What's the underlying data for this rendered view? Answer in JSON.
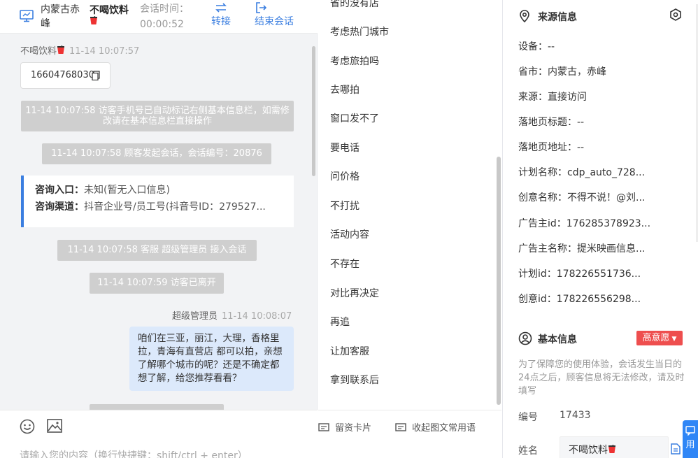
{
  "header": {
    "location": "内蒙古赤峰",
    "visitor_name": "不喝饮料",
    "session_label": "会话时间：",
    "session_time": "00:00:52",
    "transfer_label": "转接",
    "end_label": "结束会话"
  },
  "chat": {
    "visitor_name": "不喝饮料",
    "visitor_time": "11-14 10:07:57",
    "phone": "16604768030",
    "sys_auto_mark": "11-14 10:07:58 访客手机号已自动标记右侧基本信息栏，如需修改请在基本信息栏直接操作",
    "sys_session_start": "11-14 10:07:58 顾客发起会话，会话编号：20876",
    "consult_entry_label": "咨询入口：",
    "consult_entry_value": "未知(暂无入口信息)",
    "consult_channel_label": "咨询渠道：",
    "consult_channel_value": "抖音企业号/员工号(抖音号ID：279527...",
    "sys_agent_join": "11-14 10:07:58 客服 超级管理员 接入会话",
    "sys_visitor_left": "11-14 10:07:59 访客已离开",
    "agent_name": "超级管理员",
    "agent_time": "11-14 10:08:07",
    "agent_message": "咱们在三亚，丽江，大理，香格里拉，青海有直营店 都可以拍，亲想了解哪个城市的呢？还是不确定都想了解，给您推荐看看？"
  },
  "input": {
    "placeholder": "请输入您的内容（换行快捷键：shift/ctrl + enter）",
    "reserve_card": "留资卡片",
    "collapse_phrases": "收起图文常用语"
  },
  "phrases": [
    "省的没有店",
    "考虑热门城市",
    "考虑旅拍吗",
    "去哪拍",
    "窗口发不了",
    "要电话",
    "问价格",
    "不打扰",
    "活动内容",
    "不存在",
    "对比再决定",
    "再追",
    "让加客服",
    "拿到联系后"
  ],
  "source_info": {
    "title": "来源信息",
    "rows": [
      "设备：--",
      "省市：内蒙古，赤峰",
      "来源：直接访问",
      "落地页标题：--",
      "落地页地址：--",
      "计划名称：cdp_auto_728...",
      "创意名称：不得不说！@刘...",
      "广告主id：176285378923...",
      "广告主名称：提米映画信息...",
      "计划id：178226551736...",
      "创意id：178226556298..."
    ]
  },
  "basic_info": {
    "title": "基本信息",
    "intent_badge": "高意愿",
    "note": "为了保障您的使用体验，会话发生当日的24点之后，顾客信息将无法修改，请及时填写",
    "number_label": "编号",
    "number_value": "17433",
    "name_label": "姓名",
    "name_value": "不喝饮料"
  },
  "side_float": "用",
  "colors": {
    "accent": "#3a7ee0",
    "badge_red": "#ee4e4e",
    "bubble_blue": "#dce9fb"
  }
}
